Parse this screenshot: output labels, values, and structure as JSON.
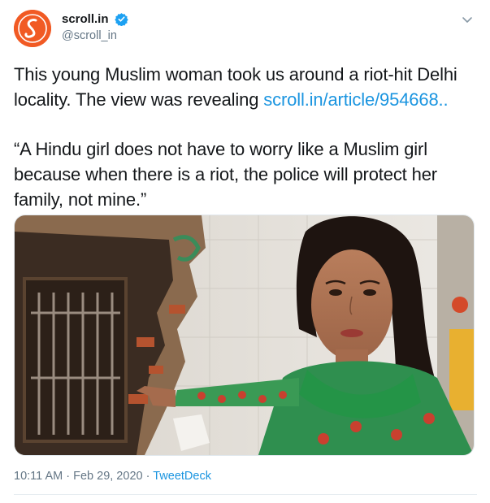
{
  "account": {
    "display_name": "scroll.in",
    "handle": "@scroll_in",
    "verified": true,
    "avatar_letter": "S",
    "avatar_color": "#f15a24"
  },
  "tweet": {
    "text_line_1": "This young Muslim woman took us around a riot-hit Delhi locality. The view was revealing ",
    "link_text": "scroll.in/article/954668..",
    "quote": "“A Hindu girl does not have to worry like a Muslim girl because when there is a riot, the police will protect her family, not mine.”"
  },
  "meta": {
    "time": "10:11 AM",
    "separator": "·",
    "date": "Feb 29, 2020",
    "source": "TweetDeck"
  },
  "colors": {
    "link": "#1b95e0",
    "muted": "#657786",
    "text": "#14171a"
  }
}
